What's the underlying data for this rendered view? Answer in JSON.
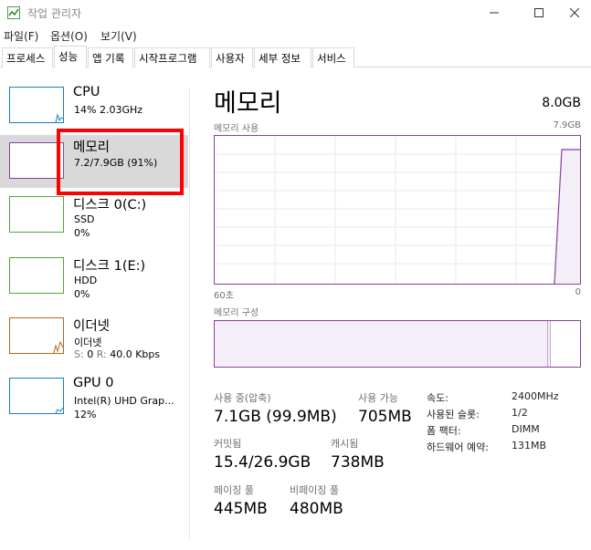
{
  "window": {
    "title": "작업 관리자"
  },
  "menu": [
    "파일(F)",
    "옵션(O)",
    "보기(V)"
  ],
  "tabs": [
    "프로세스",
    "성능",
    "앱 기록",
    "시작프로그램",
    "사용자",
    "세부 정보",
    "서비스"
  ],
  "sidebar": {
    "cpu": {
      "title": "CPU",
      "line1": "14% 2.03GHz",
      "color": "#1a7fc1"
    },
    "memory": {
      "title": "메모리",
      "line1": "7.2/7.9GB (91%)",
      "color": "#8b3fa0"
    },
    "disk0": {
      "title": "디스크 0(C:)",
      "line1": "SSD",
      "line2": "0%",
      "color": "#4da833"
    },
    "disk1": {
      "title": "디스크 1(E:)",
      "line1": "HDD",
      "line2": "0%",
      "color": "#4da833"
    },
    "ethernet": {
      "title": "이더넷",
      "line1": "이더넷",
      "line2_s": "S:",
      "line2_sv": "0",
      "line2_r": "R:",
      "line2_rv": "40.0 Kbps",
      "color": "#b9651c"
    },
    "gpu": {
      "title": "GPU 0",
      "line1": "Intel(R) UHD Grap...",
      "line2": "12%",
      "color": "#1a7fc1"
    }
  },
  "main": {
    "title": "메모리",
    "total": "8.0GB",
    "usage_label": "메모리 사용",
    "usage_max": "7.9GB",
    "time_left": "60초",
    "time_right": "0",
    "composition_label": "메모리 구성",
    "in_use": {
      "label": "사용 중(압축)",
      "value": "7.1GB (99.9MB)"
    },
    "available": {
      "label": "사용 가능",
      "value": "705MB"
    },
    "committed": {
      "label": "커밋됨",
      "value": "15.4/26.9GB"
    },
    "cached": {
      "label": "캐시됨",
      "value": "738MB"
    },
    "paged_pool": {
      "label": "페이징 풀",
      "value": "445MB"
    },
    "nonpaged_pool": {
      "label": "비페이징 풀",
      "value": "480MB"
    },
    "specs": [
      {
        "label": "속도:",
        "value": "2400MHz"
      },
      {
        "label": "사용된 슬롯:",
        "value": "1/2"
      },
      {
        "label": "폼 팩터:",
        "value": "DIMM"
      },
      {
        "label": "하드웨어 예약:",
        "value": "131MB"
      }
    ]
  }
}
